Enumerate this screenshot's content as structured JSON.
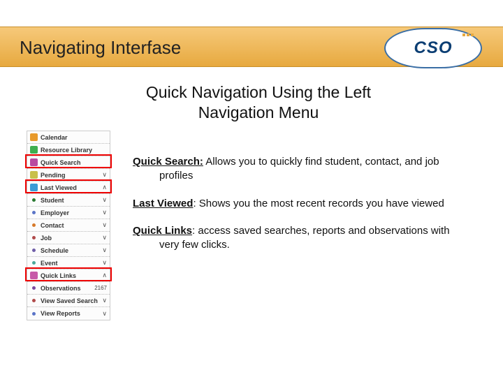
{
  "header": {
    "title": "Navigating Interfase"
  },
  "logo": {
    "text": "CSO"
  },
  "subtitle": "Quick Navigation Using the Left Navigation Menu",
  "nav": {
    "items": [
      {
        "label": "Calendar",
        "iconColor": "#e89a2b",
        "expand": ""
      },
      {
        "label": "Resource Library",
        "iconColor": "#3fae4f",
        "expand": ""
      },
      {
        "label": "Quick Search",
        "iconColor": "#b94aa0",
        "expand": ""
      },
      {
        "label": "Pending",
        "iconColor": "#c9c04a",
        "expand": "∨"
      },
      {
        "label": "Last Viewed",
        "iconColor": "#3b9bd6",
        "expand": "∧"
      },
      {
        "label": "Student",
        "bullet": "#2a7a32",
        "expand": "∨"
      },
      {
        "label": "Employer",
        "bullet": "#5a74c7",
        "expand": "∨"
      },
      {
        "label": "Contact",
        "bullet": "#d6792a",
        "expand": "∨"
      },
      {
        "label": "Job",
        "bullet": "#b04a4a",
        "expand": "∨"
      },
      {
        "label": "Schedule",
        "bullet": "#6f5ea8",
        "expand": "∨"
      },
      {
        "label": "Event",
        "bullet": "#4aa89a",
        "expand": "∨"
      },
      {
        "label": "Quick Links",
        "iconColor": "#c75aa8",
        "expand": "∧"
      },
      {
        "label": "Observations",
        "bullet": "#7a4aa0",
        "count": "2167"
      },
      {
        "label": "View Saved Search",
        "bullet": "#b04a4a",
        "expand": "∨"
      },
      {
        "label": "View Reports",
        "bullet": "#5a74c7",
        "expand": "∨"
      }
    ]
  },
  "content": {
    "p1": {
      "lead": "Quick Search:",
      "rest": " Allows you to quickly find student, contact, and job profiles"
    },
    "p2": {
      "lead": "Last Viewed",
      "rest": ":  Shows you the most recent records you have viewed"
    },
    "p3": {
      "lead": "Quick Links",
      "rest": ": access saved searches, reports and observations with very few clicks."
    }
  }
}
